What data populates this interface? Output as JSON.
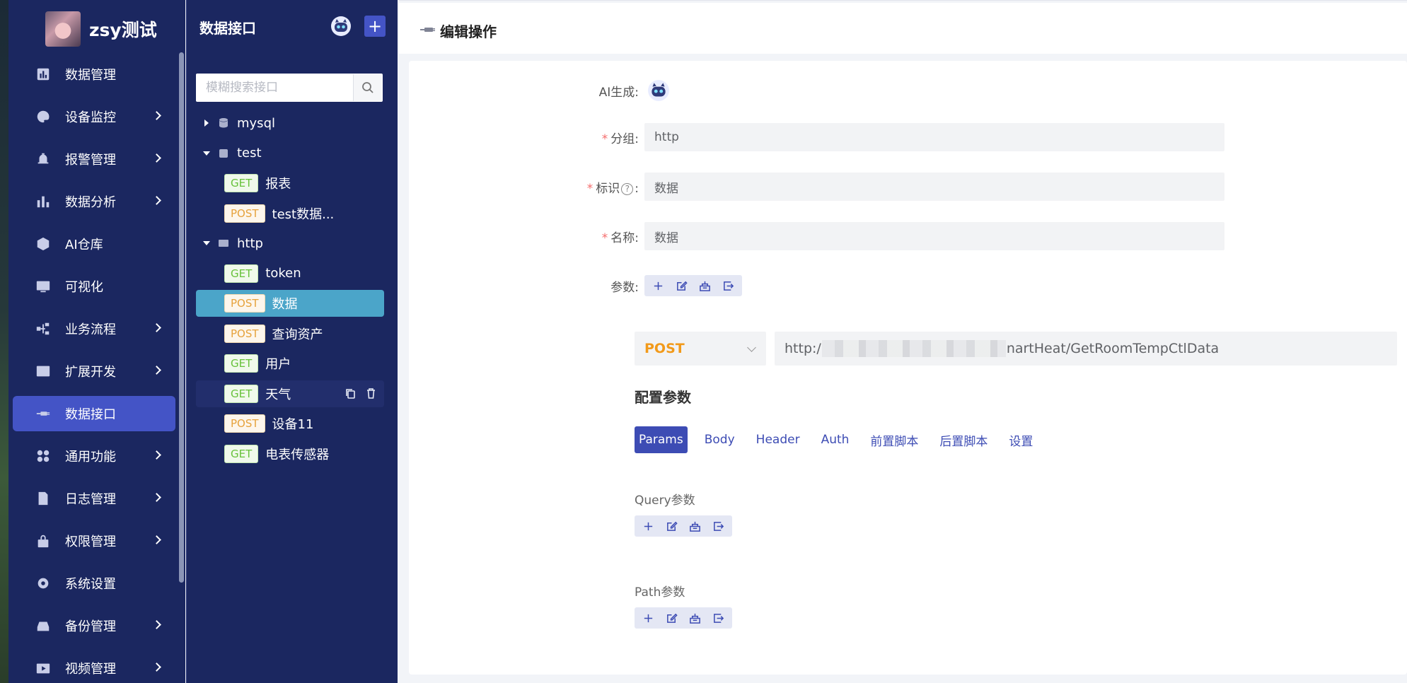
{
  "brand": {
    "name": "zsy测试"
  },
  "sidebar": {
    "items": [
      {
        "label": "数据管理",
        "icon": "bar-chart-icon",
        "has_submenu": false
      },
      {
        "label": "设备监控",
        "icon": "palette-icon",
        "has_submenu": true
      },
      {
        "label": "报警管理",
        "icon": "alarm-bell-icon",
        "has_submenu": true
      },
      {
        "label": "数据分析",
        "icon": "analytics-icon",
        "has_submenu": true
      },
      {
        "label": "AI仓库",
        "icon": "ai-icon",
        "has_submenu": false
      },
      {
        "label": "可视化",
        "icon": "screen-icon",
        "has_submenu": false
      },
      {
        "label": "业务流程",
        "icon": "flow-icon",
        "has_submenu": true
      },
      {
        "label": "扩展开发",
        "icon": "code-icon",
        "has_submenu": true
      },
      {
        "label": "数据接口",
        "icon": "plug-icon",
        "has_submenu": false,
        "active": true
      },
      {
        "label": "通用功能",
        "icon": "apps-icon",
        "has_submenu": true
      },
      {
        "label": "日志管理",
        "icon": "log-icon",
        "has_submenu": true
      },
      {
        "label": "权限管理",
        "icon": "lock-icon",
        "has_submenu": true
      },
      {
        "label": "系统设置",
        "icon": "gear-icon",
        "has_submenu": false
      },
      {
        "label": "备份管理",
        "icon": "backup-icon",
        "has_submenu": true
      },
      {
        "label": "视频管理",
        "icon": "video-icon",
        "has_submenu": true
      }
    ]
  },
  "panel": {
    "title": "数据接口",
    "add_label": "+",
    "search_placeholder": "模糊搜索接口",
    "tree": [
      {
        "type": "group",
        "label": "mysql",
        "expanded": false,
        "icon": "database-icon"
      },
      {
        "type": "group",
        "label": "test",
        "expanded": true,
        "icon": "ai-chip-icon"
      },
      {
        "type": "leaf",
        "method": "GET",
        "label": "报表"
      },
      {
        "type": "leaf",
        "method": "POST",
        "label": "test数据..."
      },
      {
        "type": "group",
        "label": "http",
        "expanded": true,
        "icon": "http-icon"
      },
      {
        "type": "leaf",
        "method": "GET",
        "label": "token"
      },
      {
        "type": "leaf",
        "method": "POST",
        "label": "数据",
        "selected": true
      },
      {
        "type": "leaf",
        "method": "POST",
        "label": "查询资产"
      },
      {
        "type": "leaf",
        "method": "GET",
        "label": "用户"
      },
      {
        "type": "leaf",
        "method": "GET",
        "label": "天气",
        "hovered": true
      },
      {
        "type": "leaf",
        "method": "POST",
        "label": "设备11"
      },
      {
        "type": "leaf",
        "method": "GET",
        "label": "电表传感器"
      }
    ]
  },
  "main": {
    "title": "编辑操作",
    "form": {
      "ai_label": "AI生成",
      "group_label": "分组",
      "group_value": "http",
      "id_label": "标识",
      "id_value": "数据",
      "name_label": "名称",
      "name_value": "数据",
      "params_label": "参数"
    },
    "request": {
      "method": "POST",
      "url_prefix": "http:/",
      "url_suffix": "nartHeat/GetRoomTempCtlData"
    },
    "config": {
      "title": "配置参数",
      "tabs": [
        "Params",
        "Body",
        "Header",
        "Auth",
        "前置脚本",
        "后置脚本",
        "设置"
      ],
      "active_tab": "Params",
      "query_label": "Query参数",
      "path_label": "Path参数"
    }
  },
  "colors": {
    "sidebar_bg": "#1b2760",
    "accent": "#4454c6",
    "selected_row": "#4ba5c9",
    "get": "#67c23a",
    "post": "#e6a23c"
  }
}
